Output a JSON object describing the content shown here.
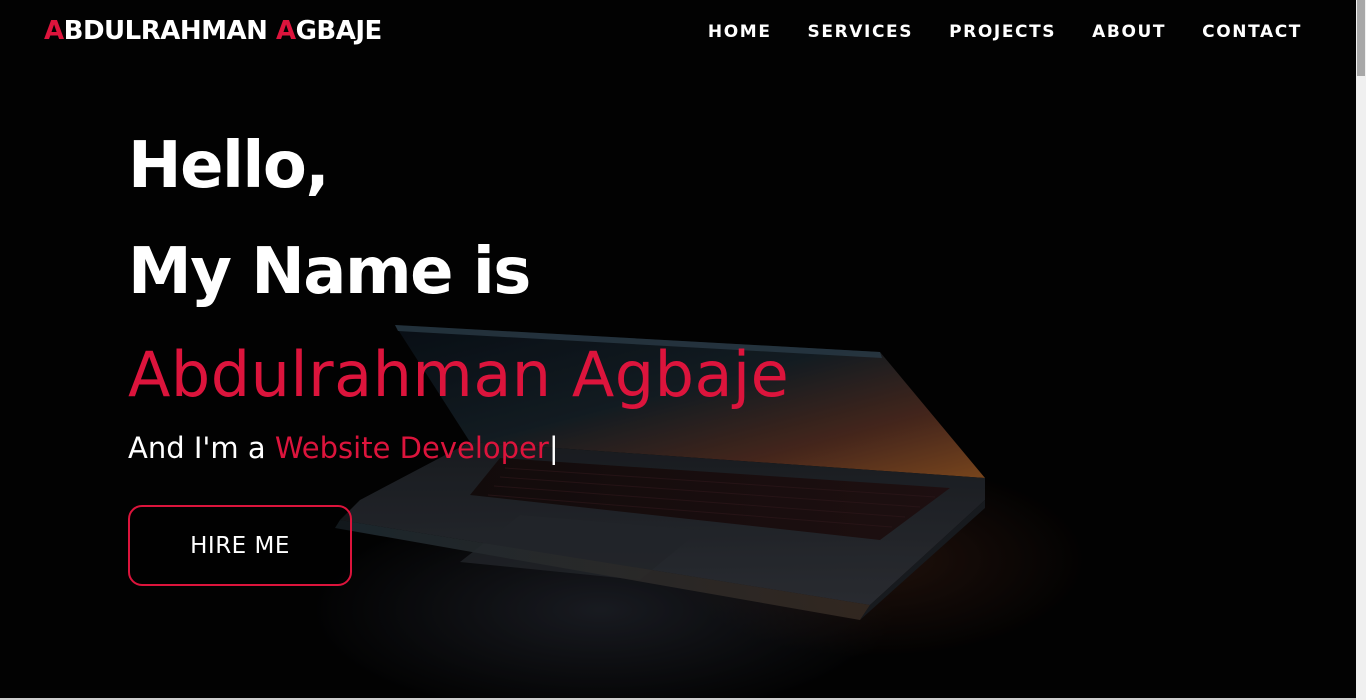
{
  "brand": {
    "first_initial": "A",
    "first_rest": "BDULRAHMAN",
    "last_initial": "A",
    "last_rest": "GBAJE"
  },
  "nav": {
    "items": [
      {
        "label": "HOME"
      },
      {
        "label": "SERVICES"
      },
      {
        "label": "PROJECTS"
      },
      {
        "label": "ABOUT"
      },
      {
        "label": "CONTACT"
      }
    ]
  },
  "hero": {
    "greeting": "Hello,",
    "intro": "My Name is",
    "name": "Abdulrahman Agbaje",
    "tagline_prefix": "And I'm a ",
    "tagline_role": "Website Developer",
    "cursor": "|",
    "hire_label": "HIRE ME"
  },
  "colors": {
    "accent": "#dc143c",
    "background": "#000000",
    "text": "#ffffff"
  }
}
